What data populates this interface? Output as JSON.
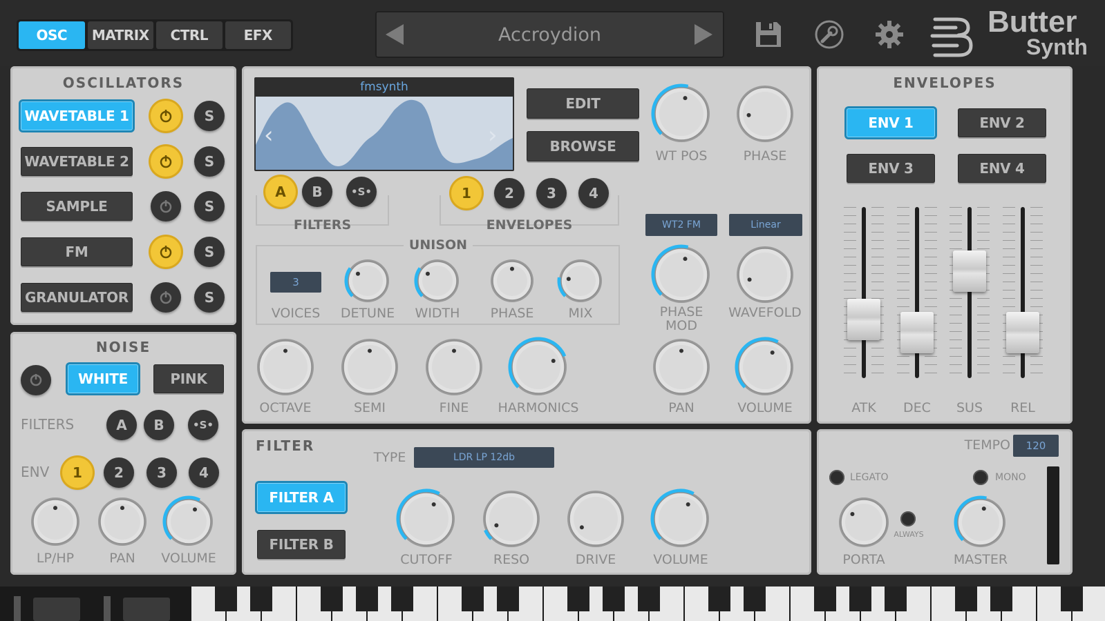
{
  "nav": {
    "tabs": [
      "OSC",
      "MATRIX",
      "CTRL",
      "EFX"
    ],
    "active": "OSC"
  },
  "preset": {
    "name": "Accroydion"
  },
  "logo": {
    "line1": "Butter",
    "line2": "Synth"
  },
  "oscillators": {
    "title": "OSCILLATORS",
    "rows": [
      {
        "label": "WAVETABLE 1",
        "active": true,
        "power": true,
        "solo": "S"
      },
      {
        "label": "WAVETABLE 2",
        "active": false,
        "power": true,
        "solo": "S"
      },
      {
        "label": "SAMPLE",
        "active": false,
        "power": false,
        "solo": "S"
      },
      {
        "label": "FM",
        "active": false,
        "power": true,
        "solo": "S"
      },
      {
        "label": "GRANULATOR",
        "active": false,
        "power": false,
        "solo": "S"
      }
    ]
  },
  "noise": {
    "title": "NOISE",
    "white": "WHITE",
    "pink": "PINK",
    "filters_label": "FILTERS",
    "filter_a": "A",
    "filter_b": "B",
    "filter_s": "•S•",
    "env_label": "ENV",
    "env": [
      "1",
      "2",
      "3",
      "4"
    ],
    "knobs": [
      "LP/HP",
      "PAN",
      "VOLUME"
    ],
    "knob_levels": [
      0.5,
      0.5,
      0.6
    ]
  },
  "wavetable": {
    "name": "fmsynth",
    "edit": "EDIT",
    "browse": "BROWSE",
    "filters_label": "FILTERS",
    "filter_a": "A",
    "filter_b": "B",
    "filter_s": "•S•",
    "envelopes_label": "ENVELOPES",
    "env": [
      "1",
      "2",
      "3",
      "4"
    ],
    "unison_label": "UNISON",
    "voices": "3",
    "unison_knobs": [
      "VOICES",
      "DETUNE",
      "WIDTH",
      "PHASE",
      "MIX"
    ],
    "top_knobs": [
      "WT POS",
      "PHASE"
    ],
    "wt_fm": "WT2 FM",
    "mode": "Linear",
    "mid_knobs": [
      "PHASE MOD",
      "WAVEFOLD"
    ],
    "bottom_knobs": [
      "OCTAVE",
      "SEMI",
      "FINE",
      "HARMONICS"
    ],
    "right_knobs": [
      "PAN",
      "VOLUME"
    ]
  },
  "envelopes": {
    "title": "ENVELOPES",
    "buttons": [
      "ENV 1",
      "ENV 2",
      "ENV 3",
      "ENV 4"
    ],
    "sliders": [
      "ATK",
      "DEC",
      "SUS",
      "REL"
    ],
    "slider_levels": [
      0.25,
      0.15,
      0.62,
      0.15
    ]
  },
  "filter": {
    "title": "FILTER",
    "type_label": "TYPE",
    "type_value": "LDR LP 12db",
    "filter_a": "FILTER A",
    "filter_b": "FILTER B",
    "knobs": [
      "CUTOFF",
      "RESO",
      "DRIVE",
      "VOLUME"
    ]
  },
  "master": {
    "tempo_label": "TEMPO",
    "tempo": "120",
    "legato": "LEGATO",
    "mono": "MONO",
    "always": "ALWAYS",
    "porta": "PORTA",
    "master": "MASTER"
  },
  "colors": {
    "accent": "#2ab6f2",
    "yellow": "#f2c637",
    "panel": "#cfcfcf",
    "dark": "#2b2b2b"
  }
}
